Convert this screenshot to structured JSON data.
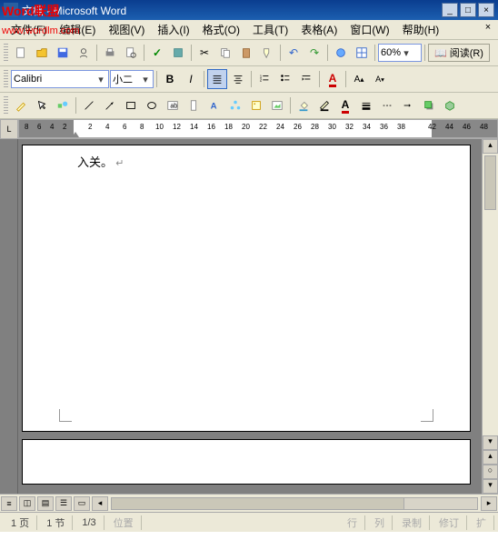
{
  "title": "文档 - Microsoft Word",
  "watermark1": "Word联盟",
  "watermark2": "www.wordlm.com",
  "menu": {
    "file": "文件(F)",
    "edit": "编辑(E)",
    "view": "视图(V)",
    "insert": "插入(I)",
    "format": "格式(O)",
    "tools": "工具(T)",
    "table": "表格(A)",
    "window": "窗口(W)",
    "help": "帮助(H)"
  },
  "toolbar1": {
    "zoom": "60%",
    "read": "阅读(R)"
  },
  "toolbar2": {
    "font": "Calibri",
    "size": "小二"
  },
  "ruler": {
    "left_nums": [
      "8",
      "6",
      "4",
      "2"
    ],
    "right_nums": [
      "2",
      "4",
      "6",
      "8",
      "10",
      "12",
      "14",
      "16",
      "18",
      "20",
      "22",
      "24",
      "26",
      "28",
      "30",
      "32",
      "34",
      "36",
      "38"
    ],
    "far_nums": [
      "42",
      "44",
      "46",
      "48"
    ]
  },
  "document": {
    "text": "入关。",
    "end_mark": "↵"
  },
  "status": {
    "page": "1 页",
    "section": "1 节",
    "pages": "1/3",
    "pos": "位置",
    "line": "行",
    "col": "列",
    "rec": "录制",
    "rev": "修订",
    "ext": "扩"
  }
}
